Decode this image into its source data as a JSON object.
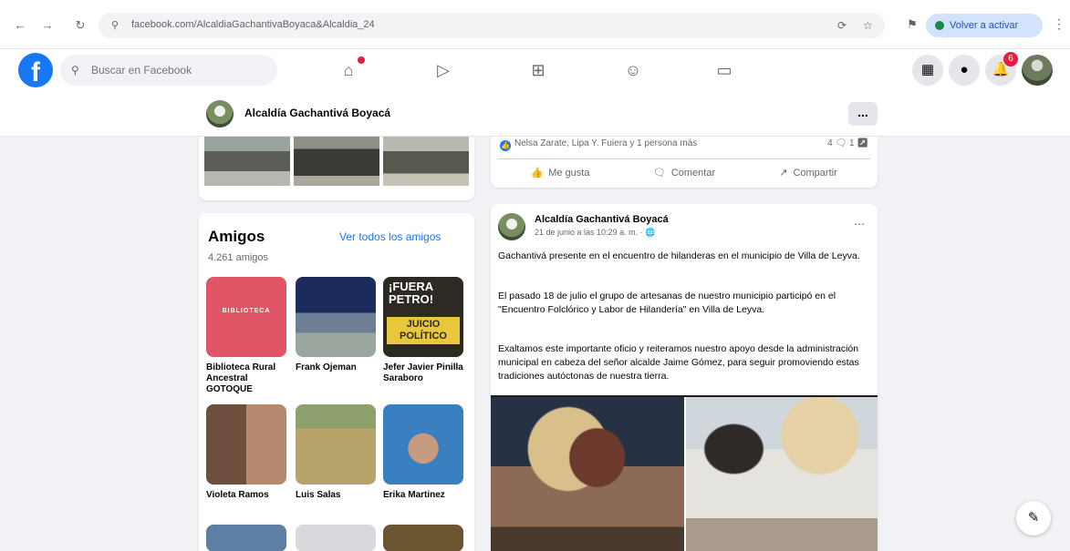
{
  "browser": {
    "url": "facebook.com/AlcaldiaGachantivaBoyaca&Alcaldia_24",
    "profile_label": "Volver a activar",
    "back_icon": "arrow-left-icon",
    "reload_icon": "reload-icon"
  },
  "header": {
    "logo": "f",
    "search_placeholder": "Buscar en Facebook",
    "notification_count": "6"
  },
  "page": {
    "name": "Alcaldía Gachantivá Boyacá",
    "more_label": "..."
  },
  "friends": {
    "title": "Amigos",
    "see_all": "Ver todos los amigos",
    "count": "4.261 amigos",
    "items": [
      {
        "name": "Biblioteca Rural Ancestral GOTOQUE"
      },
      {
        "name": "Frank Ojeman"
      },
      {
        "name": "Jefer Javier Pinilla Saraboro"
      },
      {
        "name": "Violeta Ramos"
      },
      {
        "name": "Luis Salas"
      },
      {
        "name": "Erika Martinez"
      }
    ],
    "poster_text1": "BIBLIOTECA",
    "poster_text2": "¡FUERA PETRO!",
    "poster_text3": "JUICIO POLÍTICO"
  },
  "actions": {
    "reactions_text": "Nelsa Zarate, Lipa Y. Fuiera y 1 persona más",
    "counts_text": "4 🗨 1 ↗",
    "like": "Me gusta",
    "comment": "Comentar",
    "share": "Compartir"
  },
  "post": {
    "author": "Alcaldía Gachantivá Boyacá",
    "date": "21 de junio a las 10:29 a. m. · 🌐",
    "dots": "...",
    "p1": "Gachantivá presente en el encuentro de hilanderas en el municipio de Villa de Leyva.",
    "p2": "El pasado 18 de julio el grupo de artesanas de nuestro municipio participó en el \"Encuentro Folclórico y Labor de Hilandería\" en Villa de Leyva.",
    "p3": "Exaltamos este importante oficio y reiteramos nuestro apoyo desde la administración municipal en cabeza del señor alcalde Jaime Gómez, para seguir promoviendo estas tradiciones autóctonas de nuestra tierra."
  }
}
